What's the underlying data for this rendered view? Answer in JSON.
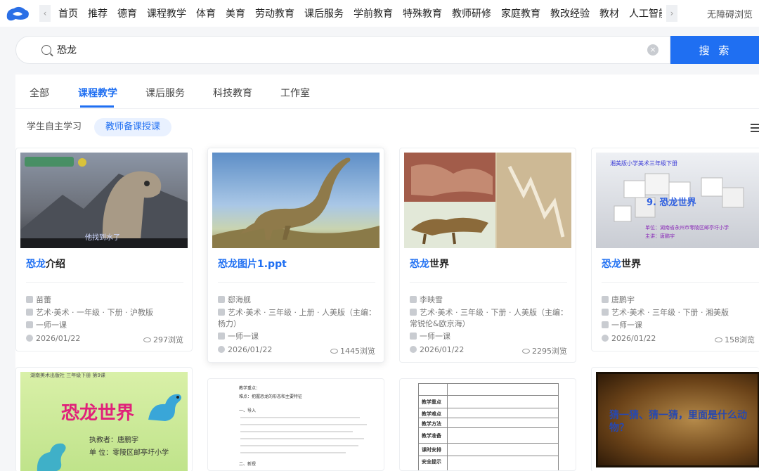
{
  "nav": {
    "items": [
      "首页",
      "推荐",
      "德育",
      "课程教学",
      "体育",
      "美育",
      "劳动教育",
      "课后服务",
      "学前教育",
      "特殊教育",
      "教师研修",
      "家庭教育",
      "教改经验",
      "教材",
      "人工智能教"
    ],
    "accessibility": "无障碍浏览"
  },
  "search": {
    "value": "恐龙",
    "button": "搜 索"
  },
  "tabs": [
    "全部",
    "课程教学",
    "课后服务",
    "科技教育",
    "工作室"
  ],
  "subtabs": [
    "学生自主学习",
    "教师备课授课"
  ],
  "cards": [
    {
      "title_hl": "恐龙",
      "title_rest": "介绍",
      "author": "苗蕾",
      "subject": "艺术·美术 · 一年级 · 下册 · 沪教版",
      "type": "一师一课",
      "date": "2026/01/22",
      "views": "297浏览",
      "thumb_caption": "他找到水了"
    },
    {
      "title_hl": "恐龙",
      "title_rest": "图片1.ppt",
      "author": "郄海舰",
      "subject": "艺术·美术 · 三年级 · 上册 · 人美版（主编：杨力）",
      "type": "一师一课",
      "date": "2026/01/22",
      "views": "1445浏览"
    },
    {
      "title_hl": "恐龙",
      "title_rest": "世界",
      "author": "李映雪",
      "subject": "艺术·美术 · 三年级 · 下册 · 人美版（主编：常锐伦&欧京海）",
      "type": "一师一课",
      "date": "2026/01/22",
      "views": "2295浏览"
    },
    {
      "title_hl": "恐龙",
      "title_rest": "世界",
      "author": "唐鹏宇",
      "subject": "艺术·美术 · 三年级 · 下册 · 湘美版",
      "type": "一师一课",
      "date": "2026/01/22",
      "views": "158浏览",
      "thumb_header": "湘美版小学美术三年级下册",
      "thumb_title": "9. 恐龙世界",
      "thumb_unit": "单位：湖南省永州市零陵区邮亭圩小学",
      "thumb_teacher": "主讲：唐鹏宇"
    }
  ],
  "bottom_cards": [
    {
      "title": "恐龙世界",
      "teacher": "执教者：唐鹏宇",
      "unit": "单 位：零陵区邮亭圩小学",
      "header": "湖南美术出版社  三年级下册  第9课"
    },
    {
      "lines": [
        "教学重点：",
        "难点：把握恐龙的形态和主要特征",
        "一、导入",
        "二、新授"
      ]
    },
    {
      "rows": [
        "教学重点",
        "教学难点",
        "教学方法",
        "教学准备",
        "课时安排",
        "安全提示"
      ]
    },
    {
      "text": "猜一猜、猜一猜，里面是什么动物？"
    }
  ],
  "colors": {
    "accent": "#1f6ff2"
  }
}
